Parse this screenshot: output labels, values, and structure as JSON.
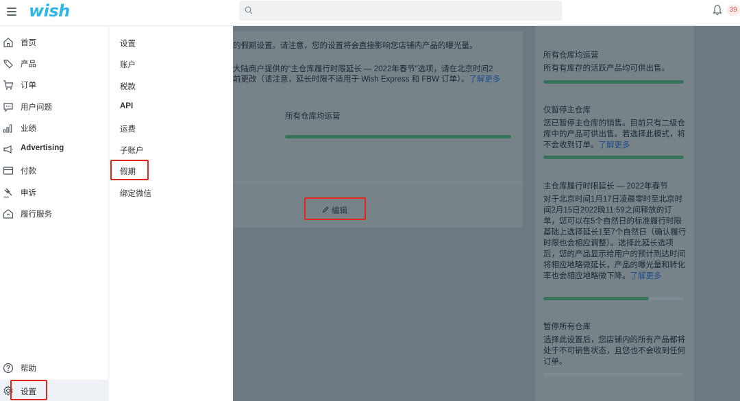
{
  "header": {
    "logo": "wish",
    "notification_count": "39"
  },
  "sidebar": {
    "items": [
      {
        "label": "首页"
      },
      {
        "label": "产品"
      },
      {
        "label": "订单"
      },
      {
        "label": "用户问题"
      },
      {
        "label": "业绩"
      },
      {
        "label": "Advertising"
      },
      {
        "label": "付款"
      },
      {
        "label": "申诉"
      },
      {
        "label": "履行服务"
      }
    ],
    "help_label": "帮助",
    "settings_label": "设置"
  },
  "submenu": {
    "items": [
      "设置",
      "账户",
      "税款",
      "API",
      "运费",
      "子账户",
      "假期",
      "绑定微信"
    ]
  },
  "main": {
    "desc_line1": "的假期设置。请注意，您的设置将会直接影响您店铺内产品的曝光量。",
    "desc_line2": "大陆商户提供的“主仓库履行时限延长 — 2022年春节”选项，请在北京时间2",
    "desc_line3": "前更改（请注意，延长时限不适用于 Wish Express 和 FBW 订单）。",
    "learn_more": "了解更多",
    "current_option": "所有仓库均运营",
    "current_progress": 1.0,
    "edit_label": "编辑"
  },
  "options": [
    {
      "title": "所有仓库均运营",
      "text": "所有有库存的活跃产品均可供出售。",
      "link": "",
      "progress": 1.0
    },
    {
      "title": "仅暂停主仓库",
      "text": "您已暂停主仓库的销售。目前只有二级仓库中的产品可供出售。若选择此模式，将不会收到订单。",
      "link": "了解更多",
      "progress": 1.0
    },
    {
      "title": "主仓库履行时限延长 — 2022年春节",
      "text": "对于北京时间1月17日凌晨零时至北京时间2月15日2022晚11:59之间释放的订单，您可以在5个自然日的标准履行时限基础上选择延长1至7个自然日（确认履行时限也会相应调整）。选择此延长选项后，您的产品显示给用户的预计到达时间将相应地略微延长，产品的曝光量和转化率也会相应地略微下降。",
      "link": "了解更多",
      "progress": 0.75
    },
    {
      "title": "暂停所有仓库",
      "text": "选择此设置后，您店铺内的所有产品都将处于不可销售状态，且您也不会收到任何订单。",
      "link": "",
      "progress": 0.0
    }
  ],
  "colors": {
    "brand": "#2fb7ec",
    "highlight": "#e0261b",
    "progress": "#37735a"
  }
}
